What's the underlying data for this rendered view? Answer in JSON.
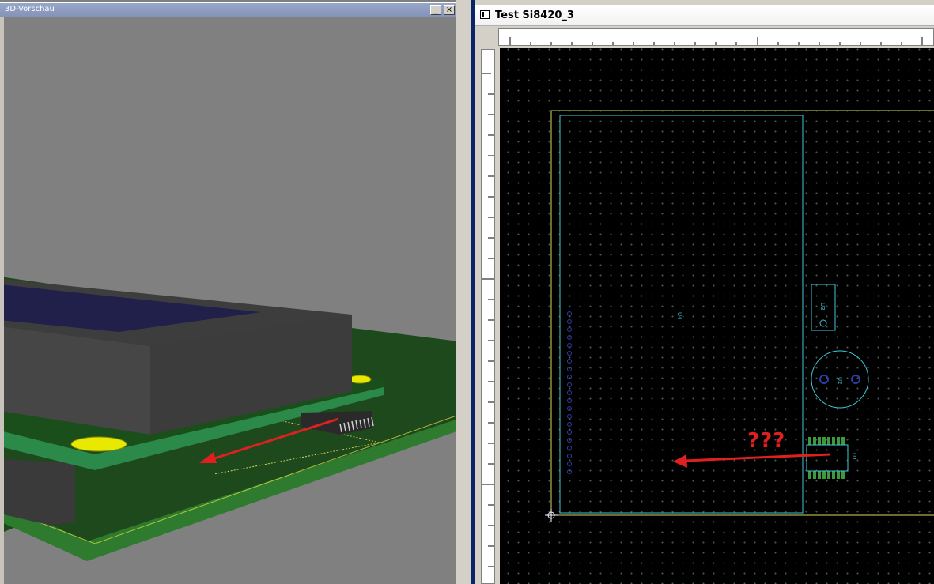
{
  "preview_window": {
    "title": "3D-Vorschau",
    "minimize_glyph": "_",
    "close_glyph": "×"
  },
  "pcb_window": {
    "title": "Test Si8420_3",
    "components": {
      "u4": "U4",
      "u3": "U3",
      "u2": "U2",
      "u1": "U1"
    },
    "annotation": "???"
  },
  "colors": {
    "annotation_red": "#e02020",
    "board_outline": "#d8d860",
    "component_outline": "#40c8d8",
    "pad_green": "#3c9a3c",
    "pcb_green": "#1f4f1f",
    "silk_yellow": "#e8e840"
  },
  "icons": {
    "window_system": "window-icon",
    "minimize": "minimize-icon",
    "close": "close-icon",
    "origin": "crosshair-icon",
    "arrow": "arrow-icon"
  }
}
